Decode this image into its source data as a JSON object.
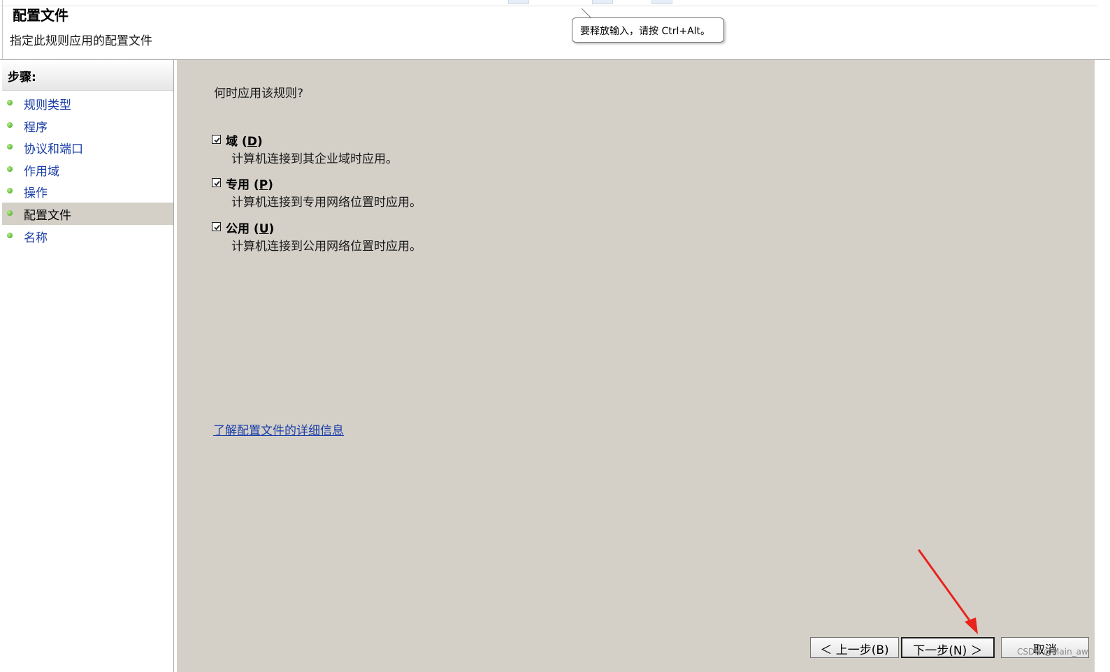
{
  "header": {
    "title": "配置文件",
    "subtitle": "指定此规则应用的配置文件"
  },
  "tooltip": {
    "text": "要释放输入，请按 Ctrl+Alt。"
  },
  "sidebar": {
    "header": "步骤:",
    "items": [
      {
        "label": "规则类型"
      },
      {
        "label": "程序"
      },
      {
        "label": "协议和端口"
      },
      {
        "label": "作用域"
      },
      {
        "label": "操作"
      },
      {
        "label": "配置文件"
      },
      {
        "label": "名称"
      }
    ],
    "active_index": 5
  },
  "main": {
    "question": "何时应用该规则?",
    "options": [
      {
        "label": "域 (D)",
        "description": "计算机连接到其企业域时应用。",
        "checked": true
      },
      {
        "label": "专用 (P)",
        "description": "计算机连接到专用网络位置时应用。",
        "checked": true
      },
      {
        "label": "公用 (U)",
        "description": "计算机连接到公用网络位置时应用。",
        "checked": true
      }
    ],
    "link": "了解配置文件的详细信息"
  },
  "buttons": {
    "back": "＜ 上一步(B)",
    "next": "下一步(N) ＞",
    "cancel": "取消"
  },
  "annotation": {
    "arrow_color": "#e8231e"
  },
  "watermark": "CSDN @Main_aw"
}
